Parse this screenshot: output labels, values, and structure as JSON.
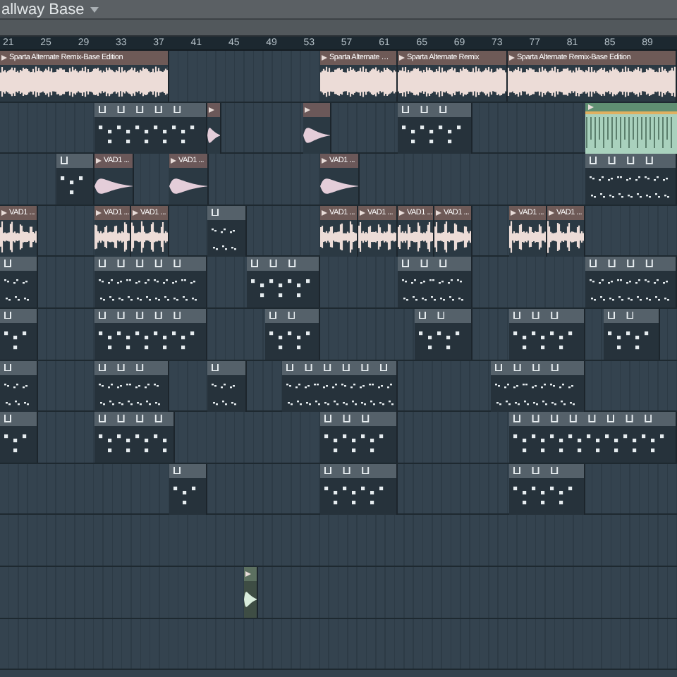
{
  "window": {
    "title": "allway Base"
  },
  "ruler": {
    "marks": [
      "21",
      "25",
      "29",
      "33",
      "37",
      "41",
      "45",
      "49",
      "53",
      "57",
      "61",
      "65",
      "69",
      "73",
      "77",
      "81",
      "85",
      "89"
    ]
  },
  "tracks": [
    {
      "clips": [
        {
          "kind": "song",
          "title": "Sparta Alternate Remix-Base Edition"
        },
        {
          "kind": "song",
          "title": "Sparta Alternate …"
        },
        {
          "kind": "song",
          "title": "Sparta Alternate Remix"
        },
        {
          "kind": "song",
          "title": "Sparta Alternate Remix-Base Edition"
        }
      ]
    },
    {
      "clips": [
        {
          "kind": "pattern"
        },
        {
          "kind": "hit"
        },
        {
          "kind": "hit"
        },
        {
          "kind": "pattern"
        },
        {
          "kind": "chord"
        }
      ]
    },
    {
      "clips": [
        {
          "kind": "pattern"
        },
        {
          "kind": "hit",
          "title": "VAD1 ..."
        },
        {
          "kind": "hit",
          "title": "VAD1 ..."
        },
        {
          "kind": "hit",
          "title": "VAD1 ..."
        },
        {
          "kind": "dense"
        }
      ]
    },
    {
      "clips": [
        {
          "kind": "loop",
          "title": "VAD1 ..."
        },
        {
          "kind": "loop",
          "title": "VAD1 ..."
        },
        {
          "kind": "loop",
          "title": "VAD1 ..."
        },
        {
          "kind": "dense"
        },
        {
          "kind": "loop",
          "title": "VAD1 ..."
        },
        {
          "kind": "loop",
          "title": "VAD1 ..."
        },
        {
          "kind": "loop",
          "title": "VAD1 ..."
        },
        {
          "kind": "loop",
          "title": "VAD1 ..."
        },
        {
          "kind": "loop",
          "title": "VAD1 ..."
        },
        {
          "kind": "loop",
          "title": "VAD1 ..."
        }
      ]
    },
    {
      "clips": [
        {
          "kind": "dense"
        },
        {
          "kind": "dense"
        },
        {
          "kind": "pattern"
        },
        {
          "kind": "dense"
        },
        {
          "kind": "dense"
        }
      ]
    },
    {
      "clips": [
        {
          "kind": "pattern"
        },
        {
          "kind": "pattern"
        },
        {
          "kind": "pattern"
        },
        {
          "kind": "pattern"
        },
        {
          "kind": "pattern"
        },
        {
          "kind": "pattern"
        }
      ]
    },
    {
      "clips": [
        {
          "kind": "dense"
        },
        {
          "kind": "dense"
        },
        {
          "kind": "dense"
        },
        {
          "kind": "dense"
        },
        {
          "kind": "dense"
        }
      ]
    },
    {
      "clips": [
        {
          "kind": "pattern"
        },
        {
          "kind": "pattern"
        },
        {
          "kind": "pattern"
        },
        {
          "kind": "pattern"
        }
      ]
    },
    {
      "clips": [
        {
          "kind": "pattern"
        },
        {
          "kind": "pattern"
        },
        {
          "kind": "pattern"
        }
      ]
    },
    {
      "clips": [
        {
          "kind": "tone"
        }
      ]
    }
  ]
}
